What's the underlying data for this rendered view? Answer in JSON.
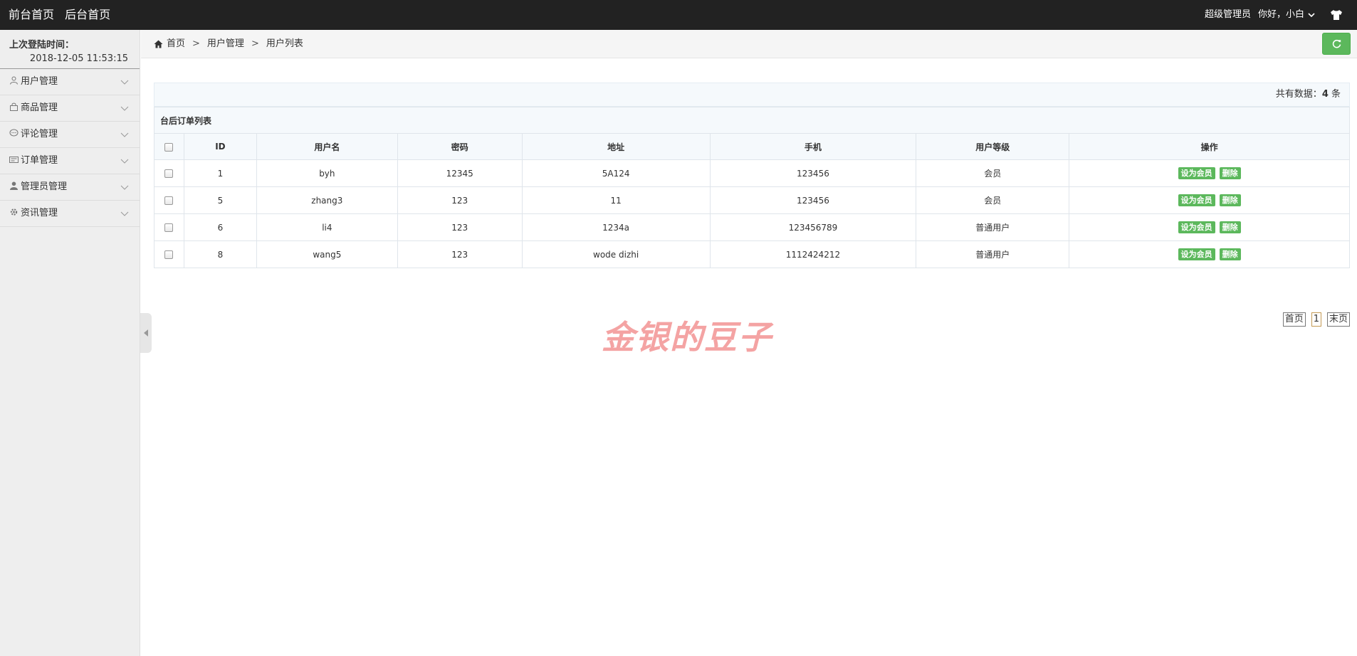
{
  "topbar": {
    "links": [
      "前台首页",
      "后台首页"
    ],
    "role": "超级管理员",
    "greeting": "你好，小白"
  },
  "sidebar": {
    "login_label": "上次登陆时间：",
    "login_time": "2018-12-05 11:53:15",
    "items": [
      {
        "label": "用户管理",
        "icon": "user-outline-icon"
      },
      {
        "label": "商品管理",
        "icon": "bag-icon"
      },
      {
        "label": "评论管理",
        "icon": "comment-icon"
      },
      {
        "label": "订单管理",
        "icon": "order-icon"
      },
      {
        "label": "管理员管理",
        "icon": "user-solid-icon"
      },
      {
        "label": "资讯管理",
        "icon": "gear-icon"
      }
    ]
  },
  "breadcrumb": [
    "首页",
    "用户管理",
    "用户列表"
  ],
  "table": {
    "total_prefix": "共有数据：",
    "total_count": "4",
    "total_suffix": " 条",
    "caption": "台后订单列表",
    "columns": [
      "ID",
      "用户名",
      "密码",
      "地址",
      "手机",
      "用户等级",
      "操作"
    ],
    "rows": [
      {
        "id": "1",
        "username": "byh",
        "password": "12345",
        "address": "5A124",
        "phone": "123456",
        "level": "会员"
      },
      {
        "id": "5",
        "username": "zhang3",
        "password": "123",
        "address": "11",
        "phone": "123456",
        "level": "会员"
      },
      {
        "id": "6",
        "username": "li4",
        "password": "123",
        "address": "1234a",
        "phone": "123456789",
        "level": "普通用户"
      },
      {
        "id": "8",
        "username": "wang5",
        "password": "123",
        "address": "wode dizhi",
        "phone": "1112424212",
        "level": "普通用户"
      }
    ],
    "actions": {
      "set_member": "设为会员",
      "delete": "删除"
    }
  },
  "pager": {
    "first": "首页",
    "current": "1",
    "last": "末页"
  },
  "watermark": "金银的豆子",
  "colors": {
    "topbar": "#222222",
    "accent": "#5cb85c",
    "sidebar": "#eeeeee"
  }
}
